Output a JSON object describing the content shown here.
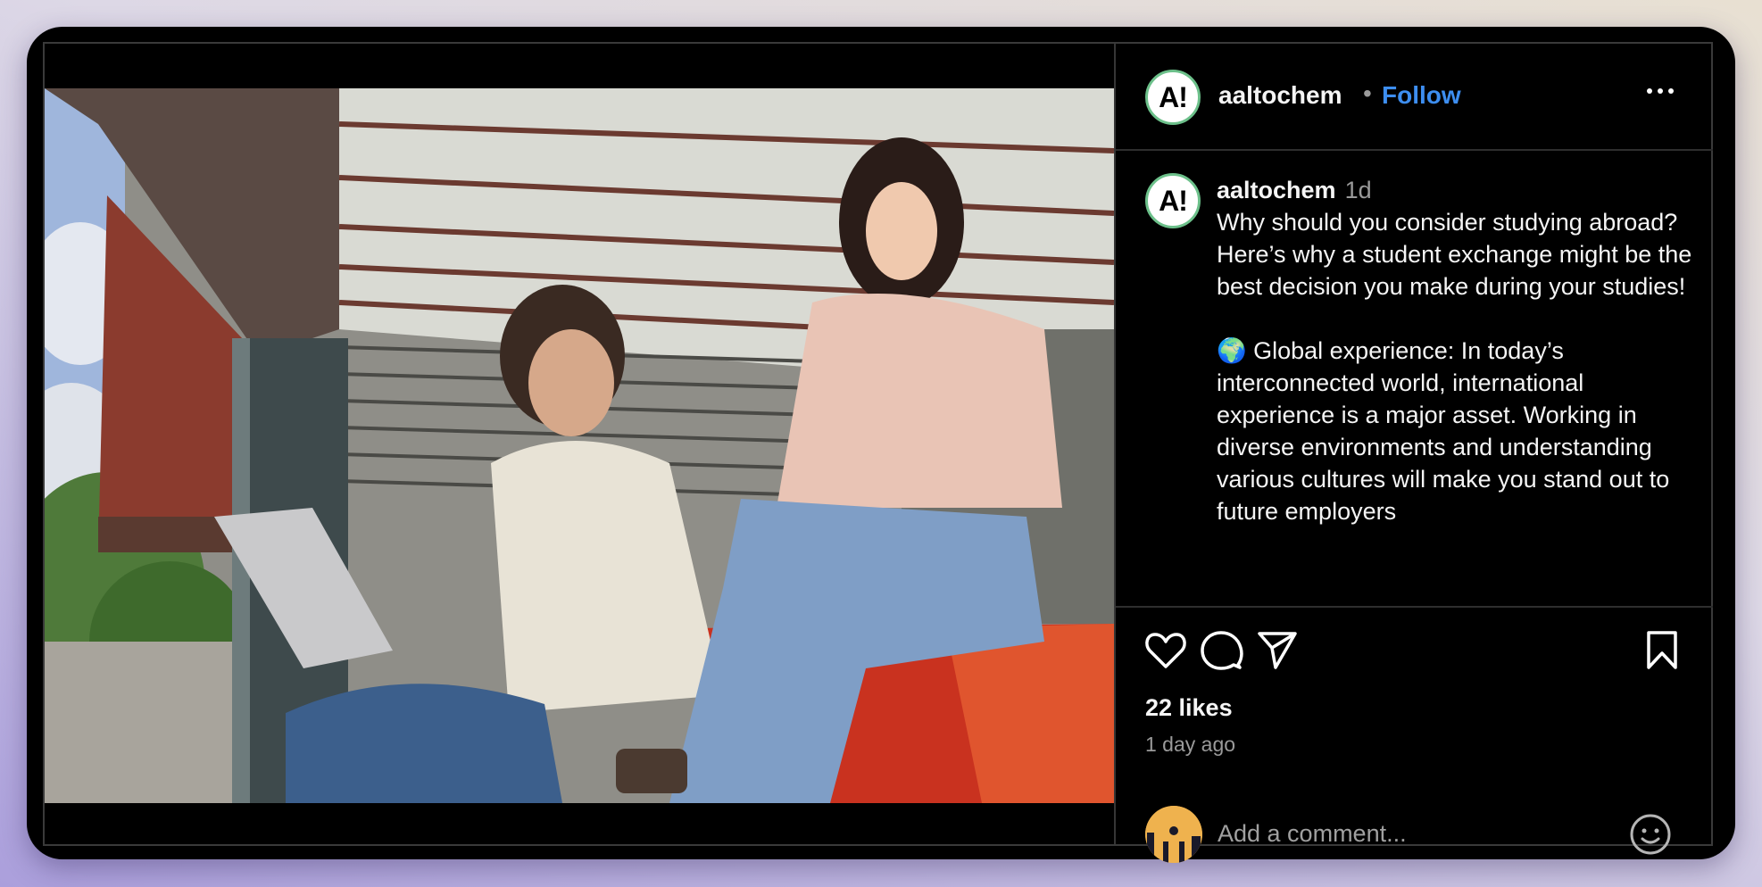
{
  "post": {
    "author": "aaltochem",
    "avatar_text": "A!",
    "separator": "•",
    "follow_label": "Follow",
    "more_icon": "more-horizontal-icon",
    "caption": {
      "author": "aaltochem",
      "time": "1d",
      "body": "Why should you consider studying abroad? Here’s why a student exchange might be the best decision you make during your studies!\n\n🌍 Global experience: In today’s interconnected world, international experience is a major asset. Working in diverse environments and understanding various cultures will make you stand out to future employers"
    },
    "actions": {
      "like_icon": "heart-icon",
      "comment_icon": "comment-icon",
      "share_icon": "paper-plane-icon",
      "save_icon": "bookmark-icon"
    },
    "likes": "22 likes",
    "posted_ago": "1 day ago",
    "comment": {
      "placeholder": "Add a comment...",
      "value": "",
      "emoji_icon": "smiley-icon"
    },
    "photo_alt": "Two students sitting outdoors under a campus building canopy; a man with curly hair holding a laptop and a woman in a pink sweater sitting on a red bench"
  },
  "colors": {
    "follow": "#3d8ef0",
    "avatar_ring": "#6cc08a",
    "user_avatar": "#efb24e",
    "background": "#000000"
  }
}
